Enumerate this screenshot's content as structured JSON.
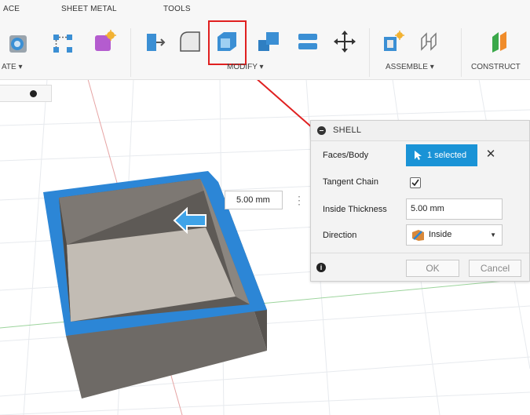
{
  "toolbar": {
    "tabs": [
      "ACE",
      "SHEET METAL",
      "TOOLS"
    ],
    "groups": {
      "create": "ATE ▾",
      "modify": "MODIFY ▾",
      "assemble": "ASSEMBLE ▾",
      "construct": "CONSTRUCT"
    }
  },
  "dimension": {
    "value": "5.00 mm"
  },
  "dialog": {
    "title": "SHELL",
    "rows": {
      "faces_label": "Faces/Body",
      "faces_value": "1 selected",
      "tangent_label": "Tangent Chain",
      "tangent_checked": true,
      "thickness_label": "Inside Thickness",
      "thickness_value": "5.00 mm",
      "direction_label": "Direction",
      "direction_value": "Inside"
    },
    "ok": "OK",
    "cancel": "Cancel",
    "info": "i"
  },
  "colors": {
    "accent": "#1a93d6",
    "highlight": "#e02020",
    "box_face": "#6e6a66",
    "box_rim": "#2c86d6"
  }
}
